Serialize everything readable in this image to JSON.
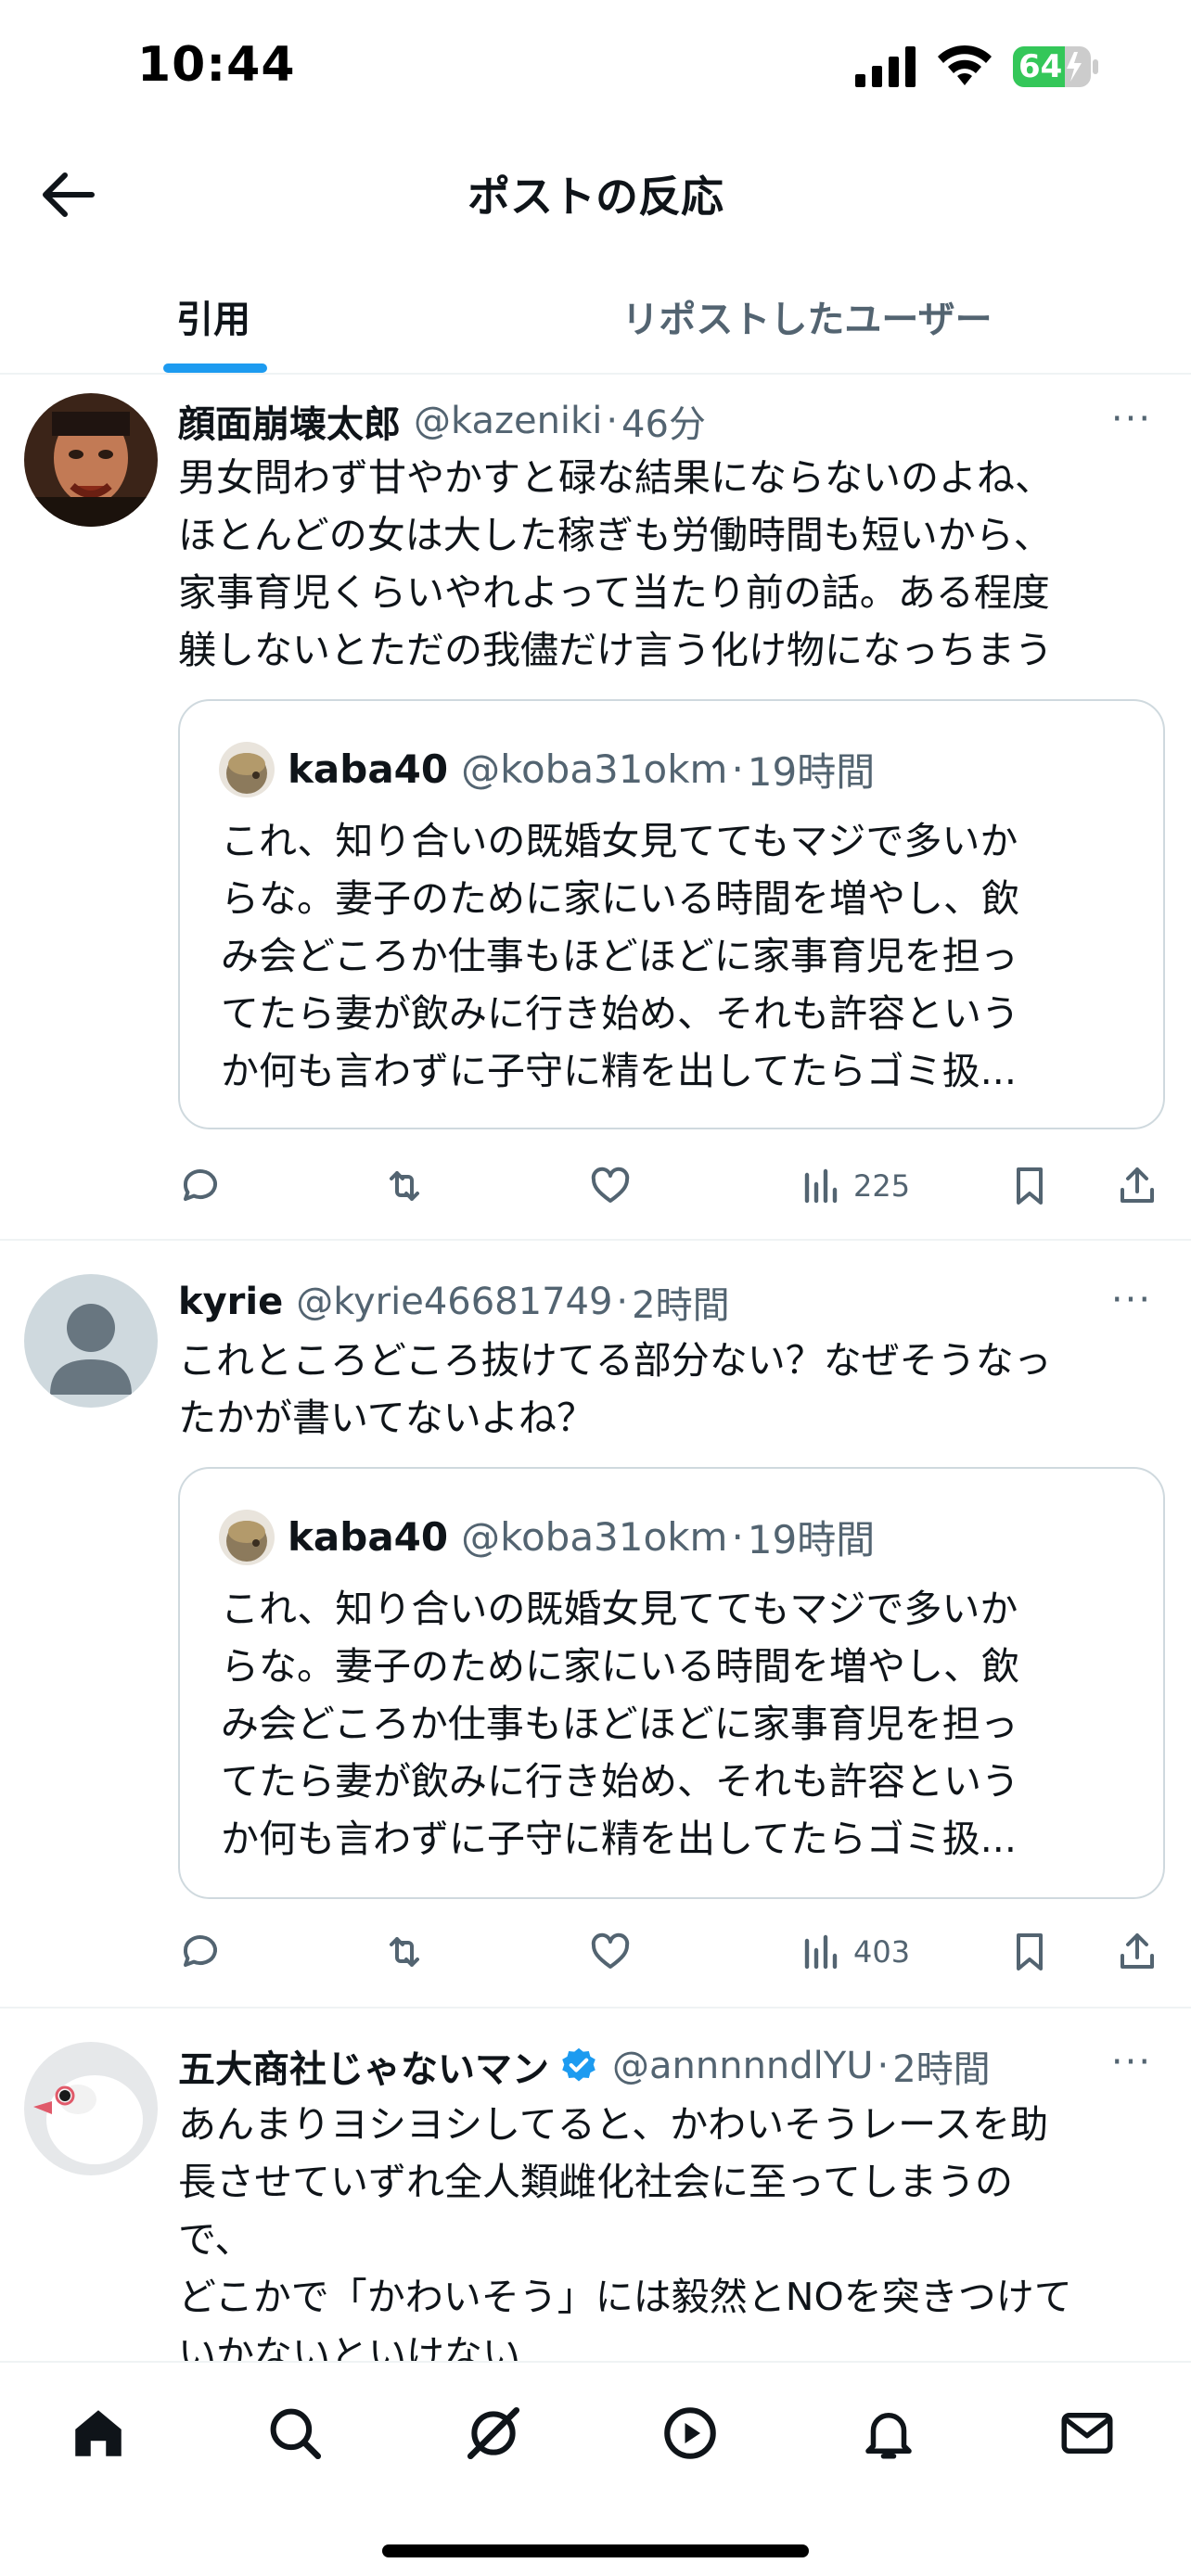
{
  "status_bar": {
    "time": "10:44",
    "battery": "64"
  },
  "header": {
    "title": "ポストの反応"
  },
  "tabs": [
    {
      "label": "引用",
      "active": true
    },
    {
      "label": "リポストしたユーザー",
      "active": false
    }
  ],
  "posts": [
    {
      "author": "顔面崩壊太郎",
      "handle": "@kazeniki",
      "dot": "·",
      "time": "46分",
      "text": "男女問わず甘やかすと碌な結果にならないのよね、\nほとんどの女は大した稼ぎも労働時間も短いから、\n家事育児くらいやれよって当たり前の話。ある程度\n躾しないとただの我儘だけ言う化け物になっちまう",
      "quote": {
        "author": "kaba40",
        "handle": "@koba31okm",
        "dot": "·",
        "time": "19時間",
        "text": "これ、知り合いの既婚女見ててもマジで多いか\nらな。妻子のために家にいる時間を増やし、飲\nみ会どころか仕事もほどほどに家事育児を担っ\nてたら妻が飲みに行き始め、それも許容という\nか何も言わずに子守に精を出してたらゴミ扱..."
      },
      "views": "225"
    },
    {
      "author": "kyrie",
      "handle": "@kyrie46681749",
      "dot": "·",
      "time": "2時間",
      "text": "これところどころ抜けてる部分ない？なぜそうなっ\nたかが書いてないよね？",
      "quote": {
        "author": "kaba40",
        "handle": "@koba31okm",
        "dot": "·",
        "time": "19時間",
        "text": "これ、知り合いの既婚女見ててもマジで多いか\nらな。妻子のために家にいる時間を増やし、飲\nみ会どころか仕事もほどほどに家事育児を担っ\nてたら妻が飲みに行き始め、それも許容という\nか何も言わずに子守に精を出してたらゴミ扱..."
      },
      "views": "403"
    },
    {
      "author": "五大商社じゃないマン",
      "handle": "@annnnndlYU",
      "dot": "·",
      "time": "2時間",
      "verified": true,
      "text": "あんまりヨシヨシしてると、かわいそうレースを助\n長させていずれ全人類雌化社会に至ってしまうの\nで、\nどこかで「かわいそう」には毅然とNOを突きつけて\nいかないといけない"
    }
  ],
  "more_glyph": "···",
  "colors": {
    "accent": "#1d9bf0",
    "text": "#0f1419",
    "secondary": "#536471",
    "border": "#cfd9de"
  },
  "icons": {
    "back": "arrow-left-icon",
    "reply": "reply-icon",
    "repost": "repost-icon",
    "like": "heart-icon",
    "views": "views-icon",
    "bookmark": "bookmark-icon",
    "share": "share-icon",
    "nav": [
      "home-icon",
      "search-icon",
      "grok-icon",
      "video-icon",
      "notifications-icon",
      "messages-icon"
    ]
  }
}
